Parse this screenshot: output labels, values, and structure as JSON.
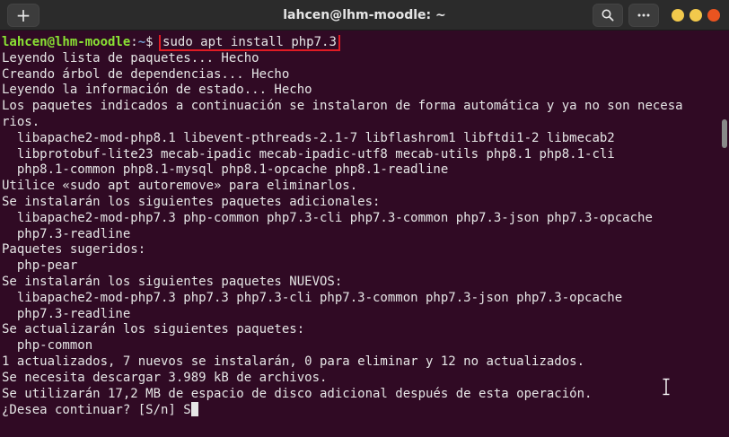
{
  "window": {
    "title": "lahcen@lhm-moodle: ~",
    "new_tab_icon": "plus-icon",
    "search_icon": "search-icon",
    "menu_icon": "ellipsis-icon"
  },
  "colors": {
    "terminal_bg": "#300a24",
    "titlebar_bg": "#2b2b2b",
    "prompt_user": "#8ae234",
    "prompt_path": "#729fcf",
    "highlight": "#e01b24",
    "close": "#e95420",
    "minmax": "#f2c94c"
  },
  "terminal": {
    "prompt": {
      "user_host": "lahcen@lhm-moodle",
      "colon": ":",
      "path": "~",
      "symbol": "$ ",
      "command": "sudo apt install php7.3"
    },
    "output": [
      "Leyendo lista de paquetes... Hecho",
      "Creando árbol de dependencias... Hecho",
      "Leyendo la información de estado... Hecho",
      "Los paquetes indicados a continuación se instalaron de forma automática y ya no son necesa",
      "rios.",
      "  libapache2-mod-php8.1 libevent-pthreads-2.1-7 libflashrom1 libftdi1-2 libmecab2",
      "  libprotobuf-lite23 mecab-ipadic mecab-ipadic-utf8 mecab-utils php8.1 php8.1-cli",
      "  php8.1-common php8.1-mysql php8.1-opcache php8.1-readline",
      "Utilice «sudo apt autoremove» para eliminarlos.",
      "Se instalarán los siguientes paquetes adicionales:",
      "  libapache2-mod-php7.3 php-common php7.3-cli php7.3-common php7.3-json php7.3-opcache",
      "  php7.3-readline",
      "Paquetes sugeridos:",
      "  php-pear",
      "Se instalarán los siguientes paquetes NUEVOS:",
      "  libapache2-mod-php7.3 php7.3 php7.3-cli php7.3-common php7.3-json php7.3-opcache",
      "  php7.3-readline",
      "Se actualizarán los siguientes paquetes:",
      "  php-common",
      "1 actualizados, 7 nuevos se instalarán, 0 para eliminar y 12 no actualizados.",
      "Se necesita descargar 3.989 kB de archivos.",
      "Se utilizarán 17,2 MB de espacio de disco adicional después de esta operación."
    ],
    "final_prompt": "¿Desea continuar? [S/n] ",
    "final_input": "S"
  }
}
